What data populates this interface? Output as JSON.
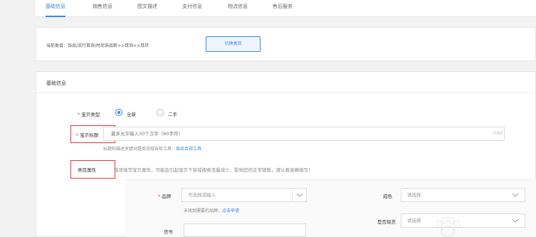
{
  "tabs": [
    {
      "label": "基础信息",
      "active": true
    },
    {
      "label": "销售信息",
      "active": false
    },
    {
      "label": "图文描述",
      "active": false
    },
    {
      "label": "支付信息",
      "active": false
    },
    {
      "label": "物流信息",
      "active": false
    },
    {
      "label": "售后服务",
      "active": false
    }
  ],
  "category": {
    "text": "当前类目：饰品/流行首饰/时尚饰品新>>耳饰>>耳环",
    "switch_label": "切换类目"
  },
  "section": {
    "title": "基础信息"
  },
  "item_type": {
    "required_mark": "*",
    "label": "宝贝类型",
    "options": [
      {
        "label": "全新",
        "checked": true
      },
      {
        "label": "二手",
        "checked": false
      }
    ]
  },
  "title_field": {
    "required_mark": "*",
    "label": "宝贝标题",
    "placeholder": "最多允许输入30个汉字（60字符）",
    "counter": "0/60",
    "hint": "标题和描述关键词是否违规自检工具：",
    "hint_link": "商品合规工具"
  },
  "attributes": {
    "label": "类目属性",
    "description": "错误填写宝贝属性，可能会引起宝贝下架或搜索流量减少，影响您的正常销售，请认真准确填写！",
    "brand": {
      "required_mark": "*",
      "label": "品牌",
      "placeholder": "可选择或输入",
      "hint": "未找到需要的品牌，",
      "hint_link": "点击申请"
    },
    "color": {
      "label": "成色",
      "placeholder": "请选择"
    },
    "origin": {
      "label": "是否现货",
      "placeholder": "请选择"
    },
    "sku": {
      "label": "货号"
    }
  },
  "colors": {
    "accent": "#3a88e8",
    "required": "#e4393c",
    "highlight": "#e53935"
  }
}
